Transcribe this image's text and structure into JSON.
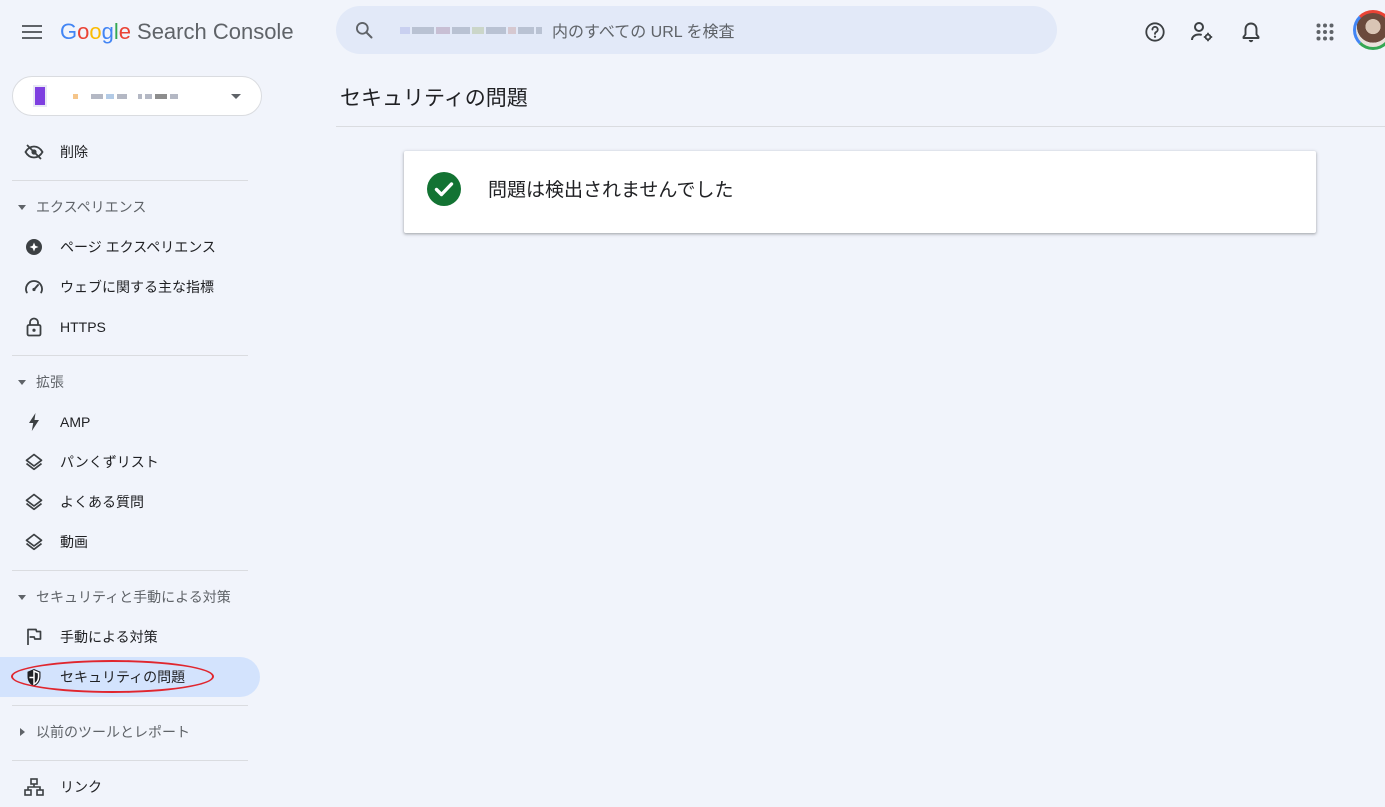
{
  "header": {
    "logo": {
      "g": "G",
      "o1": "o",
      "o2": "o",
      "g2": "g",
      "l": "l",
      "e": "e",
      "product": "Search Console"
    },
    "search_placeholder": "内のすべての URL を検査",
    "icons": [
      "menu-icon",
      "search-icon",
      "help-icon",
      "manage-users-icon",
      "notifications-icon",
      "apps-grid-icon",
      "account-avatar"
    ]
  },
  "sidebar": {
    "removals": "削除",
    "sections": {
      "experience": "エクスペリエンス",
      "enhancements": "拡張",
      "security": "セキュリティと手動による対策",
      "legacy": "以前のツールとレポート"
    },
    "items": {
      "page_experience": "ページ エクスペリエンス",
      "core_web_vitals": "ウェブに関する主な指標",
      "https": "HTTPS",
      "amp": "AMP",
      "breadcrumbs": "パンくずリスト",
      "faq": "よくある質問",
      "video": "動画",
      "manual_actions": "手動による対策",
      "security_issues": "セキュリティの問題",
      "links": "リンク"
    }
  },
  "main": {
    "title": "セキュリティの問題",
    "status_message": "問題は検出されませんでした"
  },
  "colors": {
    "background": "#f1f4fb",
    "search_bg": "#e2e9f8",
    "active_nav": "#d3e3fd",
    "success_green": "#137333",
    "annotation_red": "#e0262e",
    "property_swatch": "#7e3fe0"
  }
}
